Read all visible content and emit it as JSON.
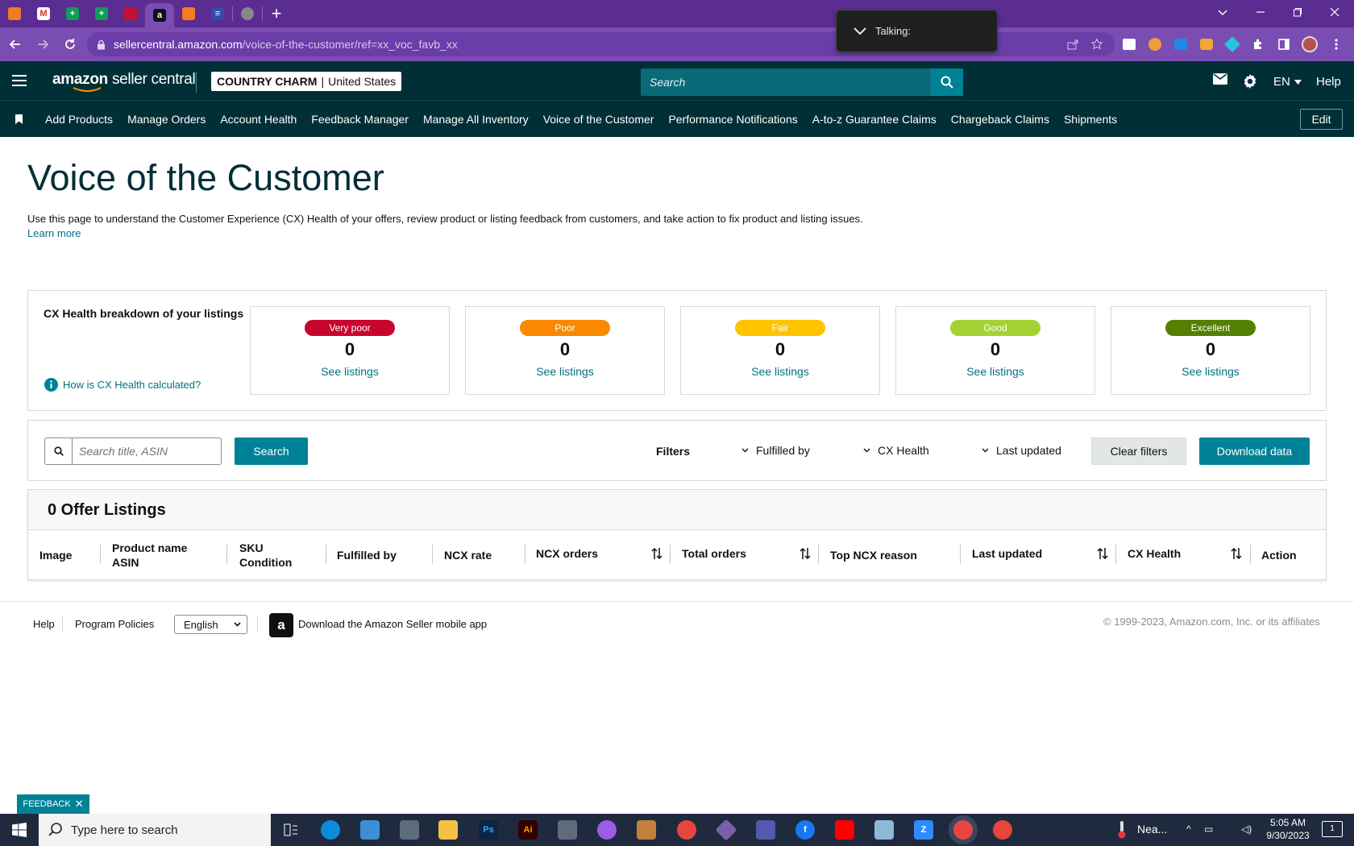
{
  "browser": {
    "url_host": "sellercentral.amazon.com",
    "url_path": "/voice-of-the-customer/ref=xx_voc_favb_xx",
    "talking_label": "Talking:",
    "tab_icons": [
      "stack-icon",
      "gmail-icon",
      "sheets-icon",
      "sheets-icon",
      "unknown-icon",
      "amazon-icon",
      "stack-icon",
      "list-icon",
      "globe-icon"
    ]
  },
  "header": {
    "brand_primary": "amazon",
    "brand_secondary": "seller central",
    "store_name": "COUNTRY CHARM",
    "store_separator": "|",
    "marketplace": "United States",
    "search_placeholder": "Search",
    "language": "EN",
    "help": "Help"
  },
  "nav": {
    "items": [
      "Add Products",
      "Manage Orders",
      "Account Health",
      "Feedback Manager",
      "Manage All Inventory",
      "Voice of the Customer",
      "Performance Notifications",
      "A-to-z Guarantee Claims",
      "Chargeback Claims",
      "Shipments"
    ],
    "edit": "Edit"
  },
  "page": {
    "title": "Voice of the Customer",
    "description": "Use this page to understand the Customer Experience (CX) Health of your offers, review product or listing feedback from customers, and take action to fix product and listing issues.",
    "learn_more": "Learn more"
  },
  "cx_health": {
    "title": "CX Health breakdown of your listings",
    "help_link": "How is CX Health calculated?",
    "cards": [
      {
        "label": "Very poor",
        "count": "0",
        "link": "See listings",
        "color": "#c7062d"
      },
      {
        "label": "Poor",
        "count": "0",
        "link": "See listings",
        "color": "#fa8900"
      },
      {
        "label": "Fair",
        "count": "0",
        "link": "See listings",
        "color": "#ffc400"
      },
      {
        "label": "Good",
        "count": "0",
        "link": "See listings",
        "color": "#a4d233"
      },
      {
        "label": "Excellent",
        "count": "0",
        "link": "See listings",
        "color": "#538000"
      }
    ]
  },
  "filters": {
    "search_placeholder": "Search title, ASIN",
    "search_button": "Search",
    "label": "Filters",
    "dropdowns": [
      "Fulfilled by",
      "CX Health",
      "Last updated"
    ],
    "clear": "Clear filters",
    "download": "Download data"
  },
  "table": {
    "title": "0 Offer Listings",
    "columns": [
      {
        "line1": "Image",
        "line2": ""
      },
      {
        "line1": "Product name",
        "line2": "ASIN"
      },
      {
        "line1": "SKU",
        "line2": "Condition"
      },
      {
        "line1": "Fulfilled by",
        "line2": ""
      },
      {
        "line1": "NCX rate",
        "line2": ""
      },
      {
        "line1": "NCX orders",
        "line2": ""
      },
      {
        "line1": "Total orders",
        "line2": ""
      },
      {
        "line1": "Top NCX reason",
        "line2": ""
      },
      {
        "line1": "Last updated",
        "line2": ""
      },
      {
        "line1": "CX Health",
        "line2": ""
      },
      {
        "line1": "Action",
        "line2": ""
      }
    ]
  },
  "footer": {
    "help": "Help",
    "policies": "Program Policies",
    "language": "English",
    "app_text": "Download the Amazon Seller mobile app",
    "copyright": "© 1999-2023, Amazon.com, Inc. or its affiliates",
    "feedback": "FEEDBACK"
  },
  "taskbar": {
    "search_placeholder": "Type here to search",
    "weather": "Nea...",
    "time": "5:05 AM",
    "date": "9/30/2023",
    "notifications": "1"
  }
}
